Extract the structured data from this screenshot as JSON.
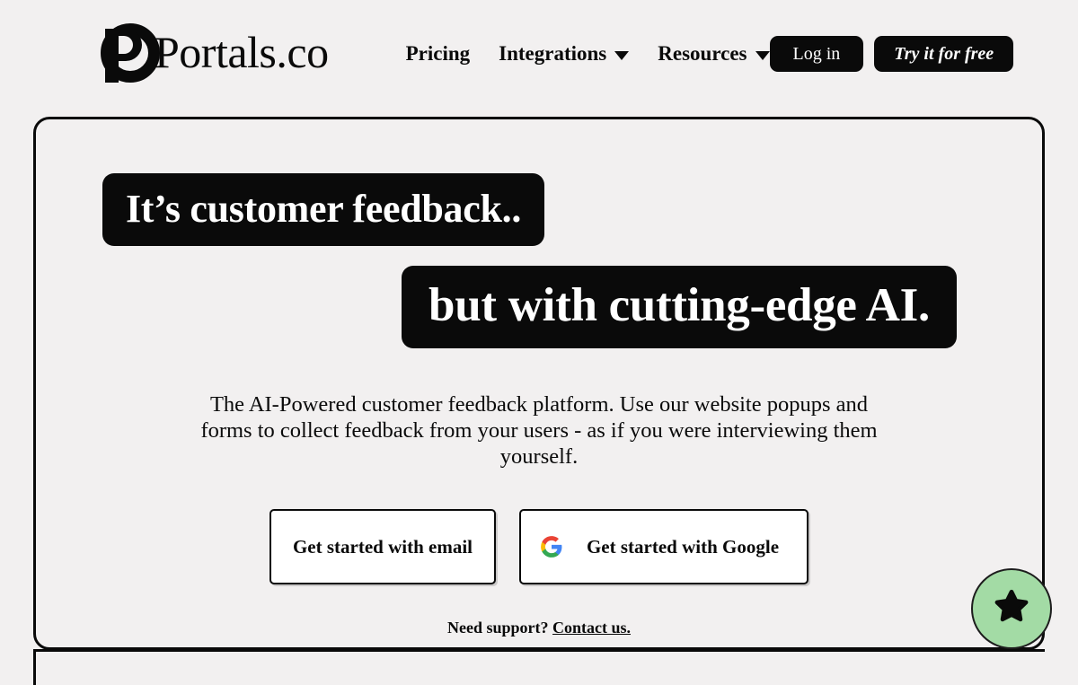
{
  "header": {
    "brand": {
      "name": "Portals.co",
      "logo_icon": "portals-p-logo-icon"
    },
    "nav": [
      {
        "label": "Pricing",
        "has_dropdown": false
      },
      {
        "label": "Integrations",
        "has_dropdown": true
      },
      {
        "label": "Resources",
        "has_dropdown": true
      }
    ],
    "auth": {
      "login_label": "Log in",
      "trial_label": "Try it for free"
    }
  },
  "hero": {
    "headline_line1": "It’s customer feedback..",
    "headline_line2": "but with cutting-edge AI.",
    "subtitle": "The AI-Powered customer feedback platform. Use our website popups and forms to collect feedback from your users - as if you were interviewing them yourself.",
    "cta": {
      "email_label": "Get started with email",
      "google_label": "Get started with Google",
      "google_icon": "google-g-icon"
    },
    "support": {
      "prompt": "Need support?",
      "link_label": "Contact us."
    }
  },
  "feedback_widget": {
    "icon": "star-icon",
    "background_color": "#a3dba5"
  },
  "colors": {
    "page_background": "#f2f0f0",
    "ink": "#0a0a0a",
    "card_border": "#0a0a0a",
    "widget_green": "#a3dba5",
    "button_surface": "#ffffff"
  }
}
